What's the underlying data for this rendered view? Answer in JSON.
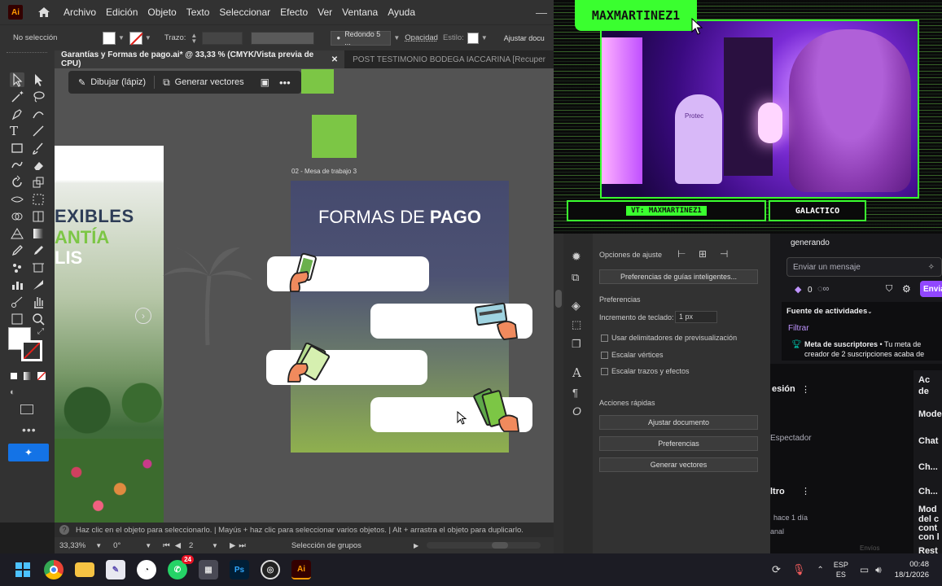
{
  "illustrator": {
    "logo": "Ai",
    "menu": [
      "Archivo",
      "Edición",
      "Objeto",
      "Texto",
      "Seleccionar",
      "Efecto",
      "Ver",
      "Ventana",
      "Ayuda"
    ],
    "control": {
      "selection": "No selección",
      "stroke_label": "Trazo:",
      "brush": "Redondo 5 ...",
      "opacity_label": "Opacidad",
      "style_label": "Estilo:",
      "adjust_doc": "Ajustar docu"
    },
    "tabs": {
      "active": "Garantías y Formas de pago.ai* @ 33,33 % (CMYK/Vista previa de CPU)",
      "inactive": "POST TESTIMONIO BODEGA IACCARINA [Recuper"
    },
    "context_bar": {
      "draw": "Dibujar (lápiz)",
      "vectors": "Generar vectores"
    },
    "artboard": {
      "label": "02 - Mesa de trabajo 3",
      "title_regular": "FORMAS DE ",
      "title_bold": "PAGO",
      "left_text_1": "EXIBLES",
      "left_text_2": "ANTÍA",
      "left_text_3": "LIS"
    },
    "status_hint": "Haz clic en el objeto para seleccionarlo.  |  Mayús + haz clic para seleccionar varios objetos.  |  Alt + arrastra el objeto para duplicarlo.",
    "zoom": "33,33%",
    "rotation": "0°",
    "page": "2",
    "status_mode": "Selección de grupos",
    "properties": {
      "snap_options": "Opciones de ajuste",
      "smart_guides": "Preferencias de guías inteligentes...",
      "preferences_header": "Preferencias",
      "keyboard_increment_label": "Incremento de teclado:",
      "keyboard_increment_value": "1 px",
      "check_preview_bounds": "Usar delimitadores de previsualización",
      "check_scale_corners": "Escalar vértices",
      "check_scale_strokes": "Escalar trazos y efectos",
      "quick_actions": "Acciones rápidas",
      "btn_fit_doc": "Ajustar documento",
      "btn_prefs": "Preferencias",
      "btn_vectors": "Generar vectores"
    }
  },
  "stream": {
    "username": "MAXMARTINEZ1",
    "lower_left": "VT: MAXMARTINEZ1",
    "lower_right": "GALACTICO",
    "protec_label": "Protec"
  },
  "chat": {
    "generating": "generando",
    "send_placeholder": "Enviar un mensaje",
    "points": "0",
    "send_button": "Envia",
    "activity_title": "Fuente de actividades",
    "filter": "Filtrar",
    "goal_title": "Meta de suscriptores",
    "goal_text": "• Tu meta de creador de 2 suscripciones acaba de",
    "bg_session": "esión",
    "bg_spectator": "Espectador",
    "bg_filter": "ltro",
    "bg_ago": "hace 1 día",
    "bg_channel": "anal",
    "bg_right": [
      "Ac",
      "Mode",
      "Chat",
      "Ch...",
      "Ch...",
      "Mod",
      "Rest"
    ],
    "bg_right_sub": [
      "de",
      "del c",
      "cont",
      "con l"
    ],
    "bg_bottom": "Envíos"
  },
  "taskbar": {
    "whatsapp_badge": "24",
    "lang_1": "ESP",
    "lang_2": "ES",
    "time": "00:48",
    "date": "18/1/2026"
  },
  "colors": {
    "accent_green": "#7cc645",
    "stream_green": "#3aff2f",
    "stream_purple": "#8b2cff",
    "twitch_purple": "#9147ff"
  }
}
